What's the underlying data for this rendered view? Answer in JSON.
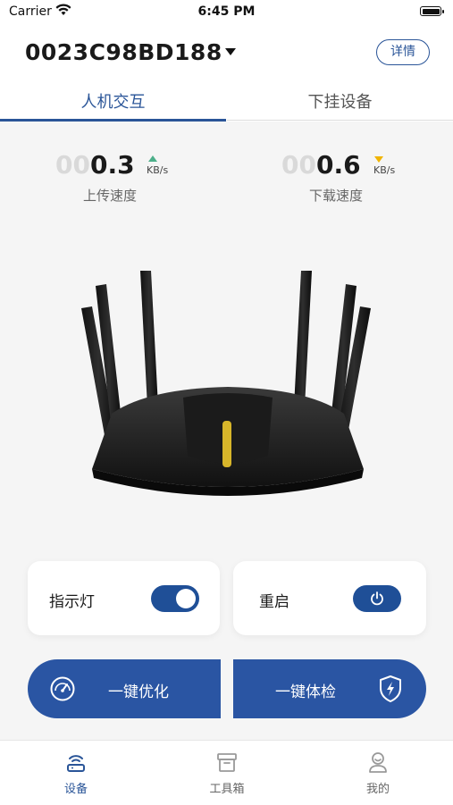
{
  "status_bar": {
    "carrier": "Carrier",
    "time": "6:45 PM"
  },
  "header": {
    "device_id": "0023C98BD188",
    "details_label": "详情"
  },
  "tabs": [
    {
      "label": "人机交互",
      "active": true
    },
    {
      "label": "下挂设备",
      "active": false
    }
  ],
  "upload": {
    "ghost_digits": "00",
    "value": "0.3",
    "unit": "KB/s",
    "label": "上传速度"
  },
  "download": {
    "ghost_digits": "00",
    "value": "0.6",
    "unit": "KB/s",
    "label": "下载速度"
  },
  "indicator_light": {
    "label": "指示灯",
    "on": true
  },
  "restart": {
    "label": "重启"
  },
  "actions": {
    "optimize_label": "一键优化",
    "checkup_label": "一键体检"
  },
  "bottom_nav": [
    {
      "label": "设备",
      "active": true,
      "icon": "router-icon"
    },
    {
      "label": "工具箱",
      "active": false,
      "icon": "toolbox-icon"
    },
    {
      "label": "我的",
      "active": false,
      "icon": "user-icon"
    }
  ],
  "colors": {
    "accent": "#2a5598",
    "button": "#2a55a3",
    "upload_arrow": "#4caf8a",
    "download_arrow": "#f0b400"
  }
}
